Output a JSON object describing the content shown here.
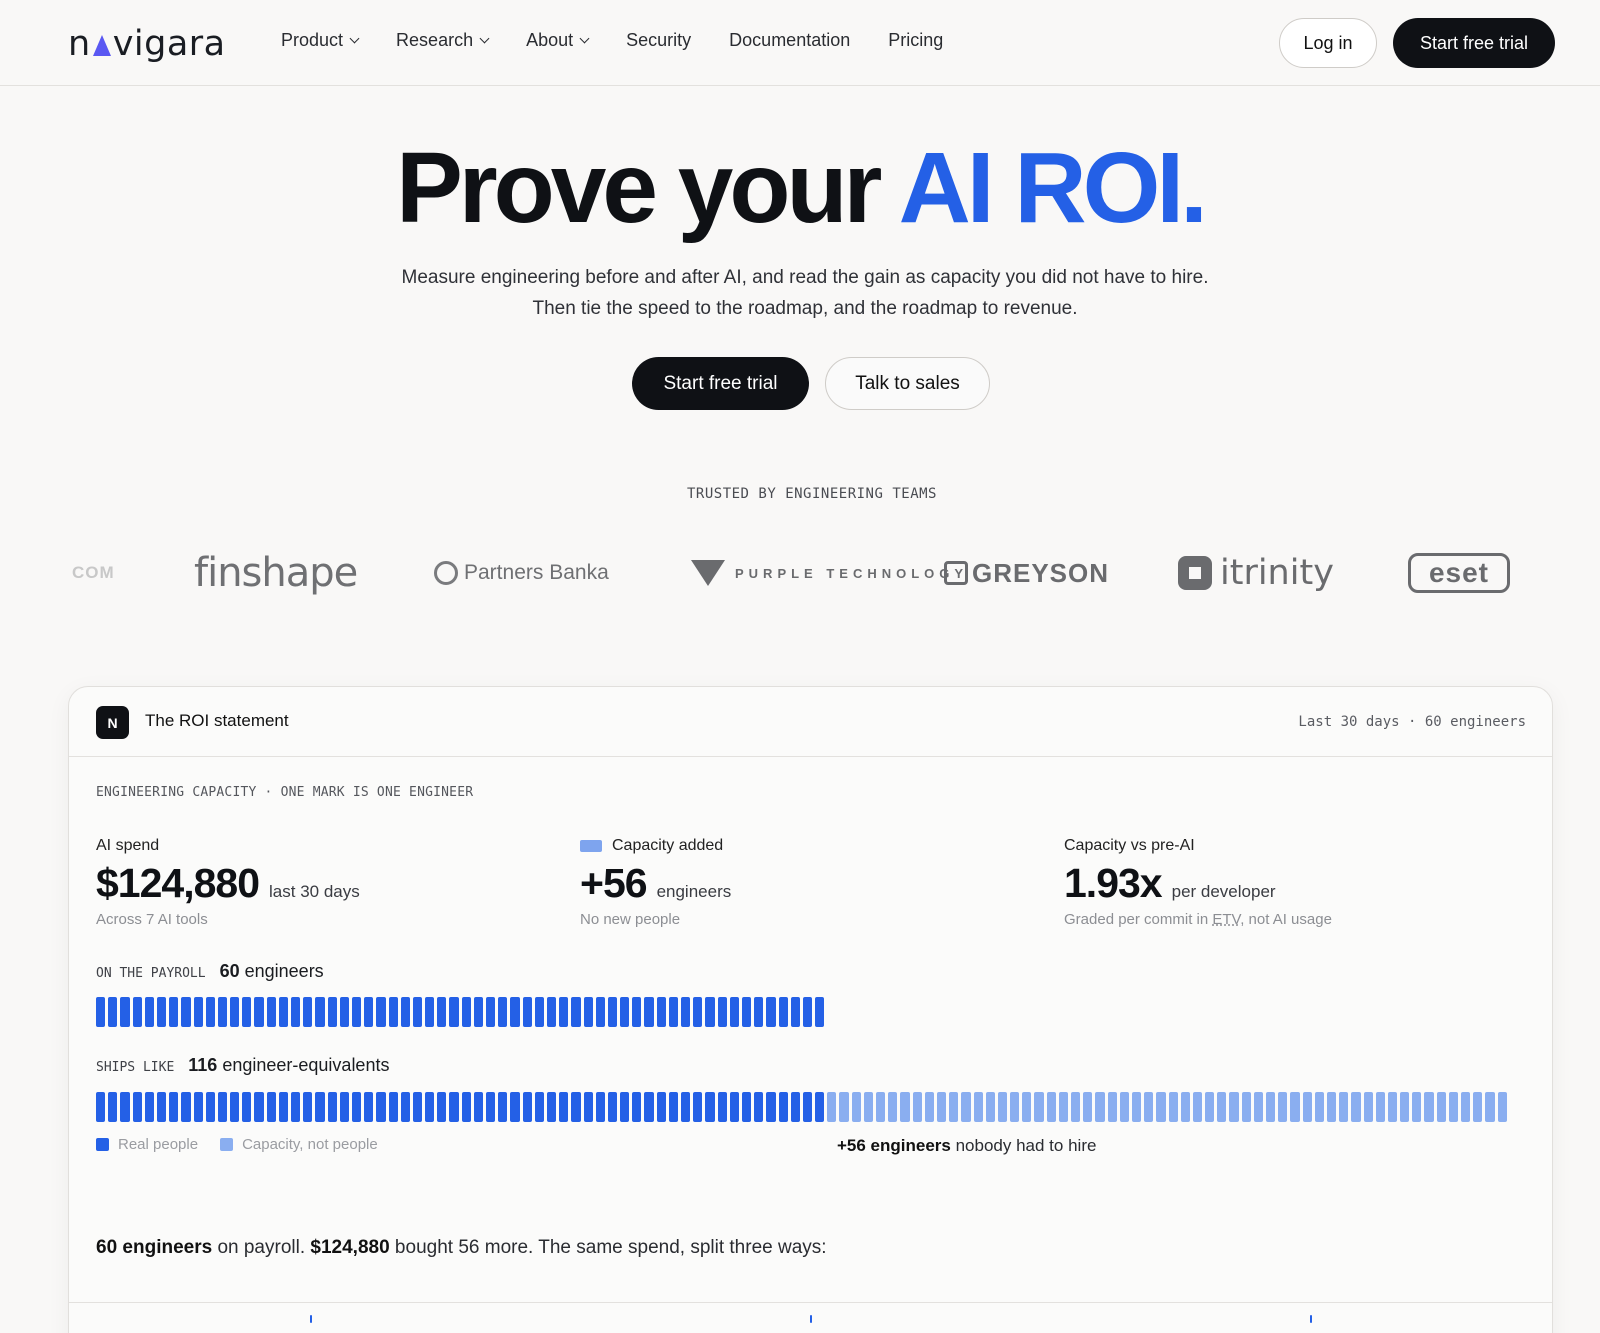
{
  "header": {
    "logo": "navigara",
    "nav": [
      {
        "label": "Product",
        "dropdown": true
      },
      {
        "label": "Research",
        "dropdown": true
      },
      {
        "label": "About",
        "dropdown": true
      },
      {
        "label": "Security",
        "dropdown": false
      },
      {
        "label": "Documentation",
        "dropdown": false
      },
      {
        "label": "Pricing",
        "dropdown": false
      }
    ],
    "login": "Log in",
    "trial": "Start free trial"
  },
  "hero": {
    "title_lead": "Prove your",
    "title_accent": "AI ROI.",
    "subtitle": "Measure engineering before and after AI, and read the gain as capacity you did not have to hire. Then tie the speed to the roadmap, and the roadmap to revenue.",
    "cta_primary": "Start free trial",
    "cta_secondary": "Talk to sales"
  },
  "trusted": {
    "label": "TRUSTED BY ENGINEERING TEAMS",
    "logos": [
      "COM",
      "finshape",
      "Partners Banka",
      "PURPLE TECHNOLOGY",
      "GREYSON",
      "itrinity",
      "eset"
    ]
  },
  "card": {
    "badge": "N",
    "title": "The ROI statement",
    "meta": "Last 30 days · 60 engineers",
    "capacity_label": "ENGINEERING CAPACITY · ONE MARK IS ONE ENGINEER",
    "stats": [
      {
        "label": "AI spend",
        "value": "$124,880",
        "unit": "last 30 days",
        "note": "Across 7 AI tools"
      },
      {
        "label": "Capacity added",
        "value": "+56",
        "unit": "engineers",
        "note": "No new people"
      },
      {
        "label": "Capacity vs pre-AI",
        "value": "1.93x",
        "unit": "per developer",
        "note_pre": "Graded per commit in ",
        "note_term": "ETV",
        "note_post": ", not AI usage"
      }
    ],
    "payroll": {
      "label": "ON THE PAYROLL",
      "count": "60",
      "unit": "engineers",
      "marks": 60
    },
    "ships": {
      "label": "SHIPS LIKE",
      "count": "116",
      "unit": "engineer-equivalents",
      "real_marks": 60,
      "capacity_marks": 56
    },
    "legend": {
      "real": "Real people",
      "capacity": "Capacity, not people"
    },
    "extra_note": {
      "bold": "+56 engineers",
      "rest": " nobody had to hire"
    },
    "summary": {
      "b1": "60 engineers",
      "t1": " on payroll. ",
      "b2": "$124,880",
      "t2": " bought 56 more. The same spend, split three ways:"
    }
  }
}
